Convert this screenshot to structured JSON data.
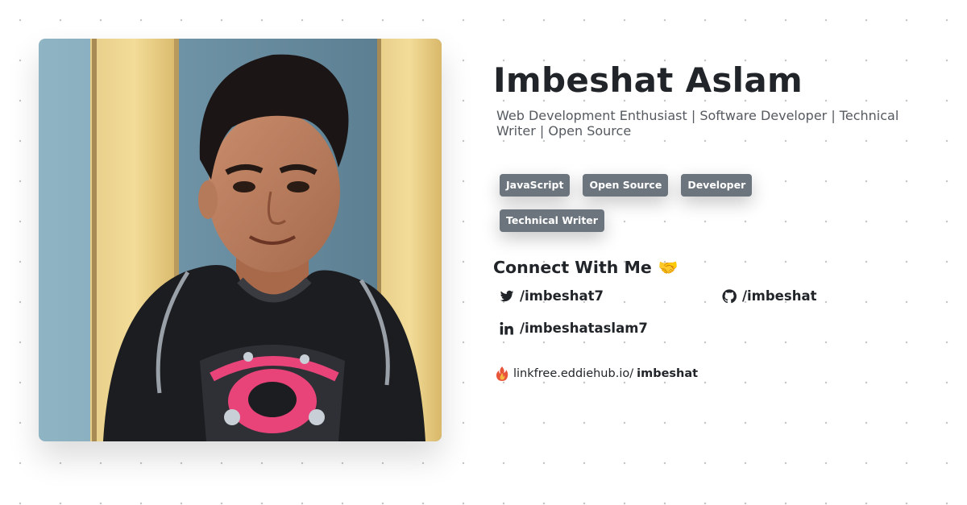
{
  "profile": {
    "name": "Imbeshat Aslam",
    "tagline": "Web Development Enthusiast | Software Developer | Technical Writer | Open Source"
  },
  "tags": [
    "JavaScript",
    "Open Source",
    "Developer",
    "Technical Writer"
  ],
  "connect": {
    "title": "Connect With Me",
    "emoji": "🤝"
  },
  "socials": {
    "twitter": {
      "handle": "/imbeshat7",
      "icon": "twitter-icon"
    },
    "github": {
      "handle": "/imbeshat",
      "icon": "github-icon"
    },
    "linkedin": {
      "handle": "/imbeshataslam7",
      "icon": "linkedin-icon"
    }
  },
  "linkfree": {
    "domain": "linkfree.eddiehub.io/",
    "username": "imbeshat",
    "icon": "flame-icon"
  },
  "colors": {
    "tag_bg": "#6c757d",
    "text": "#212529",
    "subtext": "#555a60"
  }
}
